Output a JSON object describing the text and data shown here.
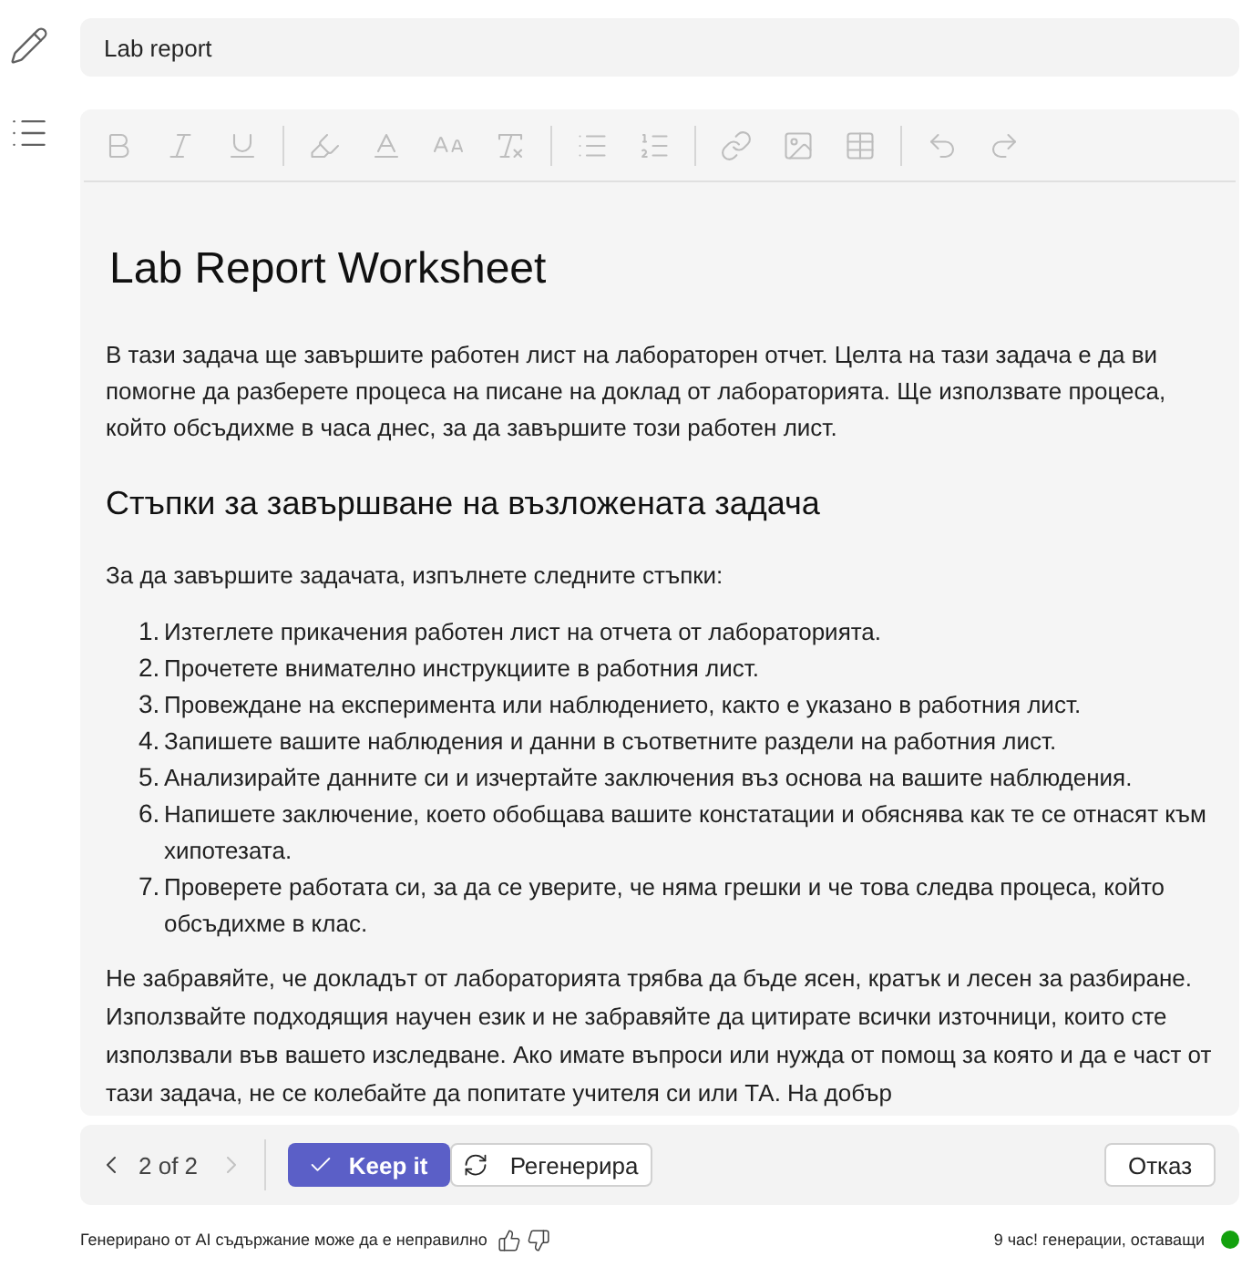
{
  "title_field": {
    "value": "Lab report"
  },
  "toolbar": {
    "disabled": true
  },
  "document": {
    "heading": "Lab Report Worksheet",
    "intro": "В тази задача ще завършите работен лист на лабораторен отчет. Целта на тази задача е да ви помогне да разберете процеса на писане на доклад от лабораторията. Ще използвате процеса, който обсъдихме в часа днес, за да завършите този работен лист.",
    "subheading": "Стъпки за завършване на възложената задача",
    "lead": "За да завършите задачата, изпълнете следните стъпки:",
    "steps": [
      {
        "number": "1.",
        "text": "Изтеглете прикачения работен лист на отчета от лабораторията."
      },
      {
        "number": "2.",
        "text": "Прочетете внимателно инструкциите в работния лист."
      },
      {
        "number": "3.",
        "text": "Провеждане на експеримента или наблюдението, както е указано в работния лист."
      },
      {
        "number": "4.",
        "text": "Запишете вашите наблюдения и данни в съответните раздели на работния лист."
      },
      {
        "number": "5.",
        "text": "Анализирайте данните си и изчертайте заключения въз основа на вашите наблюдения."
      },
      {
        "number": "6.",
        "text": "Напишете заключение, което обобщава вашите констатации и обяснява как те се отнасят към хипотезата."
      },
      {
        "number": "7.",
        "text": "Проверете работата си, за да се уверите, че няма грешки и че това следва процеса, който обсъдихме в клас."
      }
    ],
    "closing": "Не забравяйте, че докладът от лабораторията трябва да бъде ясен, кратък и лесен за разбиране. Използвайте подходящия научен език и не забравяйте да цитирате всички източници, които сте използвали във вашето изследване. Ако имате въпроси или нужда от помощ за която и да е част от тази задача, не се колебайте да попитате учителя си или ТА. На добър"
  },
  "actions": {
    "pager": {
      "label": "2 of 2",
      "previous_disabled": false,
      "next_disabled": true
    },
    "keep": "Keep it",
    "regenerate": "Регенерира",
    "cancel": "Отказ"
  },
  "footer": {
    "disclaimer": "Генерирано от AI съдържание може да е неправилно",
    "remaining": "9 час! генерации, оставащи"
  }
}
